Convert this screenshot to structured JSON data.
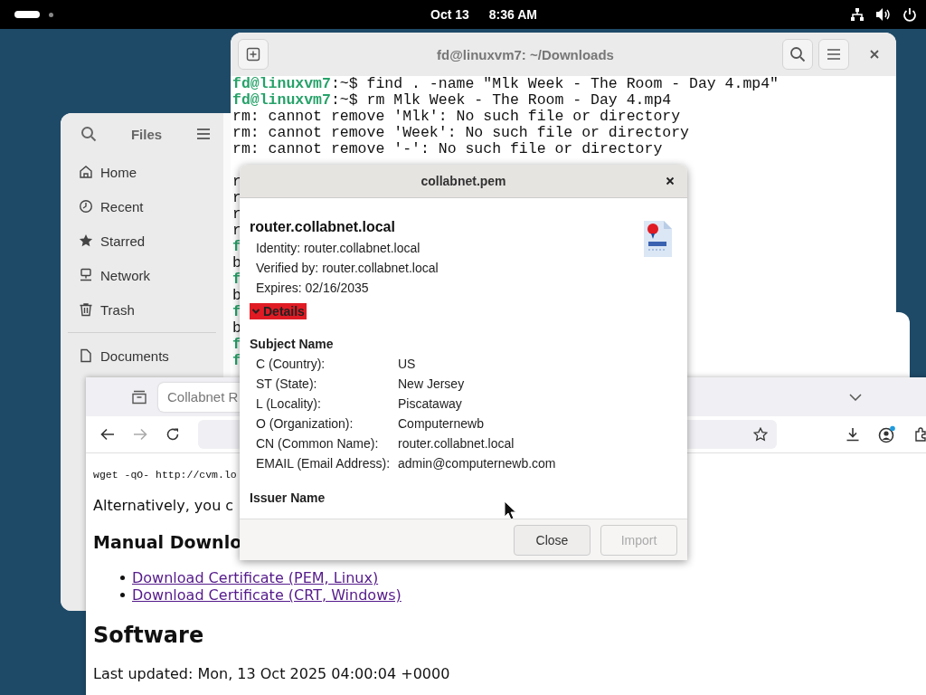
{
  "top_bar": {
    "date": "Oct 13",
    "time": "8:36 AM"
  },
  "files_window": {
    "title": "Files",
    "places": [
      {
        "label": "Home",
        "kind": "home",
        "selected": false
      },
      {
        "label": "Recent",
        "kind": "recent",
        "selected": false
      },
      {
        "label": "Starred",
        "kind": "starred",
        "selected": false
      },
      {
        "label": "Network",
        "kind": "network",
        "selected": false
      },
      {
        "label": "Trash",
        "kind": "trash",
        "selected": false
      }
    ],
    "bookmarks": [
      {
        "label": "Documents",
        "kind": "document",
        "selected": false
      }
    ]
  },
  "terminal": {
    "title": "fd@linuxvm7: ~/Downloads",
    "lines": [
      {
        "kind": "prompt",
        "user": "fd@linuxvm7",
        "text": ":~$ find . -name \"Mlk Week - The Room - Day 4.mp4\""
      },
      {
        "kind": "prompt",
        "user": "fd@linuxvm7",
        "text": ":~$ rm Mlk Week - The Room - Day 4.mp4"
      },
      {
        "kind": "output",
        "text": "rm: cannot remove 'Mlk': No such file or directory"
      },
      {
        "kind": "output",
        "text": "rm: cannot remove 'Week': No such file or directory"
      },
      {
        "kind": "output",
        "text": "rm: cannot remove '-': No such file or directory"
      }
    ],
    "covered_lines": [
      {
        "kind": "output",
        "text": "r"
      },
      {
        "kind": "output",
        "text": "r"
      },
      {
        "kind": "output",
        "text": "r"
      },
      {
        "kind": "output",
        "text": "r"
      },
      {
        "kind": "prompt",
        "user": "f"
      },
      {
        "kind": "output",
        "text": "b"
      },
      {
        "kind": "prompt",
        "user": "f"
      },
      {
        "kind": "output",
        "text": "b"
      },
      {
        "kind": "prompt",
        "user": "f"
      },
      {
        "kind": "output",
        "text": "b"
      },
      {
        "kind": "prompt",
        "user": "f"
      },
      {
        "kind": "prompt",
        "user": "f"
      }
    ]
  },
  "browser": {
    "tab": {
      "title": "Collabnet R",
      "selected": true
    },
    "account_notification": true,
    "content": {
      "command": "wget -qO- http://cvm.lo",
      "paragraph": "Alternatively, you c",
      "heading": "Manual Downlo",
      "links": [
        "Download Certificate (PEM, Linux)",
        "Download Certificate (CRT, Windows)"
      ],
      "section_heading": "Software",
      "last_updated": "Last updated: Mon, 13 Oct 2025 04:00:04 +0000"
    }
  },
  "dialog": {
    "title": "collabnet.pem",
    "name": "router.collabnet.local",
    "info": [
      "Identity: router.collabnet.local",
      "Verified by: router.collabnet.local",
      "Expires: 02/16/2035"
    ],
    "details": {
      "label": "Details",
      "expanded": true
    },
    "sections": [
      {
        "heading": "Subject Name",
        "rows": [
          {
            "label": "C (Country):",
            "value": "US"
          },
          {
            "label": "ST (State):",
            "value": "New Jersey"
          },
          {
            "label": "L (Locality):",
            "value": "Piscataway"
          },
          {
            "label": "O (Organization):",
            "value": "Computernewb"
          },
          {
            "label": "CN (Common Name):",
            "value": "router.collabnet.local"
          },
          {
            "label": "EMAIL (Email Address):",
            "value": "admin@computernewb.com"
          }
        ]
      },
      {
        "heading": "Issuer Name"
      }
    ],
    "buttons": [
      {
        "label": "Close",
        "disabled": false
      },
      {
        "label": "Import",
        "disabled": true
      }
    ]
  }
}
